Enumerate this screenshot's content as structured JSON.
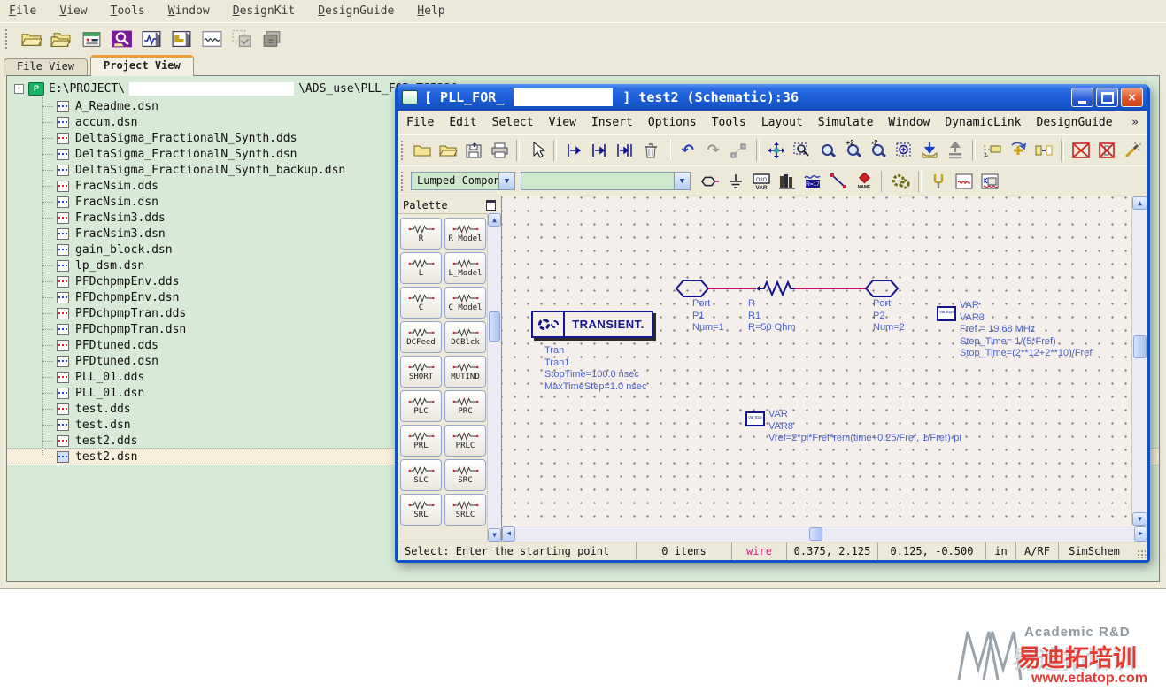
{
  "main_window": {
    "menu": [
      "File",
      "View",
      "Tools",
      "Window",
      "DesignKit",
      "DesignGuide",
      "Help"
    ],
    "toolbar_icon_names": [
      "open-project",
      "open-example-project",
      "new-project",
      "search-project",
      "new-schematic-window",
      "new-layout-window",
      "new-data-display-window",
      "simulation-status-disabled",
      "library-list-disabled"
    ],
    "tabs": [
      {
        "label": "File View"
      },
      {
        "label": "Project View"
      }
    ],
    "tree": {
      "root_prefix": "E:\\PROJECT\\",
      "root_suffix": "\\ADS_use\\PLL_FOR_TS5320",
      "items": [
        {
          "name": "A_Readme.dsn",
          "cls": "dsn"
        },
        {
          "name": "accum.dsn",
          "cls": "dsn"
        },
        {
          "name": "DeltaSigma_FractionalN_Synth.dds",
          "cls": "dds"
        },
        {
          "name": "DeltaSigma_FractionalN_Synth.dsn",
          "cls": "dsn"
        },
        {
          "name": "DeltaSigma_FractionalN_Synth_backup.dsn",
          "cls": "dsn"
        },
        {
          "name": "FracNsim.dds",
          "cls": "dds"
        },
        {
          "name": "FracNsim.dsn",
          "cls": "dsn"
        },
        {
          "name": "FracNsim3.dds",
          "cls": "dds"
        },
        {
          "name": "FracNsim3.dsn",
          "cls": "dsn"
        },
        {
          "name": "gain_block.dsn",
          "cls": "dsn"
        },
        {
          "name": "lp_dsm.dsn",
          "cls": "dsn"
        },
        {
          "name": "PFDchpmpEnv.dds",
          "cls": "dds"
        },
        {
          "name": "PFDchpmpEnv.dsn",
          "cls": "dsn"
        },
        {
          "name": "PFDchpmpTran.dds",
          "cls": "dds"
        },
        {
          "name": "PFDchpmpTran.dsn",
          "cls": "dsn"
        },
        {
          "name": "PFDtuned.dds",
          "cls": "dds"
        },
        {
          "name": "PFDtuned.dsn",
          "cls": "dsn"
        },
        {
          "name": "PLL_01.dds",
          "cls": "dds"
        },
        {
          "name": "PLL_01.dsn",
          "cls": "dsn"
        },
        {
          "name": "test.dds",
          "cls": "dds"
        },
        {
          "name": "test.dsn",
          "cls": "dsn"
        },
        {
          "name": "test2.dds",
          "cls": "dds"
        },
        {
          "name": "test2.dsn",
          "cls": "dsn selected"
        }
      ]
    }
  },
  "schematic_window": {
    "title_prefix": "[ PLL_FOR_",
    "title_suffix": "] test2 (Schematic):36",
    "menu": [
      "File",
      "Edit",
      "Select",
      "View",
      "Insert",
      "Options",
      "Tools",
      "Layout",
      "Simulate",
      "Window",
      "DynamicLink",
      "DesignGuide"
    ],
    "menu_overflow": "»",
    "toolbars": {
      "palette_select": "Lumped-Components",
      "component_select": ""
    },
    "palette": {
      "title": "Palette",
      "items": [
        "R",
        "R_Model",
        "L",
        "L_Model",
        "C",
        "C_Model",
        "DCFeed",
        "DCBlck",
        "SHORT",
        "MUTIND",
        "PLC",
        "PRC",
        "PRL",
        "PRLC",
        "SLC",
        "SRC",
        "SRL",
        "SRLC"
      ]
    },
    "schematic": {
      "transient_label": "TRANSIENT.",
      "transient_lines": [
        "Tran",
        "Tran1",
        "StopTime=100.0 nsec",
        "MaxTimeStep=1.0 nsec"
      ],
      "port1_lines": [
        "Port",
        "P1",
        "Num=1"
      ],
      "resistor_lines": [
        "R",
        "R1",
        "R=50 Ohm"
      ],
      "port2_lines": [
        "Port",
        "P2",
        "Num=2"
      ],
      "var3_lines": [
        "VAR",
        "VAR3",
        "Fref = 19.68 MHz",
        "Step_Time= 1/(5*Fref)",
        "Stop_Time=(2**12+2**10)/Fref"
      ],
      "var8_lines": [
        "VAR",
        "VAR8",
        "Vref=2*pi*Fref*rem(time+0.25/Fref, 1/Fref)-pi"
      ],
      "var_icon_text": "Var Eqn"
    },
    "status_bar": {
      "message": "Select: Enter the starting point",
      "items": "0 items",
      "mode": "wire",
      "coord_a": "0.375,  2.125",
      "coord_b": "0.125, -0.500",
      "units": "in",
      "tech": "A/RF",
      "tool": "SimSchem"
    }
  },
  "watermark": {
    "line1": "Academic R&D",
    "line2": "易迪拓培训",
    "line3": "www.edatop.com"
  },
  "colors": {
    "titlebar_blue": "#1c5ed8",
    "close_red": "#dc5224",
    "wire_magenta": "#c2126e",
    "component_navy": "#15158c",
    "label_blue": "#4a62c8",
    "tree_bg_green": "#d7e9d7",
    "selected_row": "#f7efdb",
    "canvas_bg": "#f5efec"
  }
}
